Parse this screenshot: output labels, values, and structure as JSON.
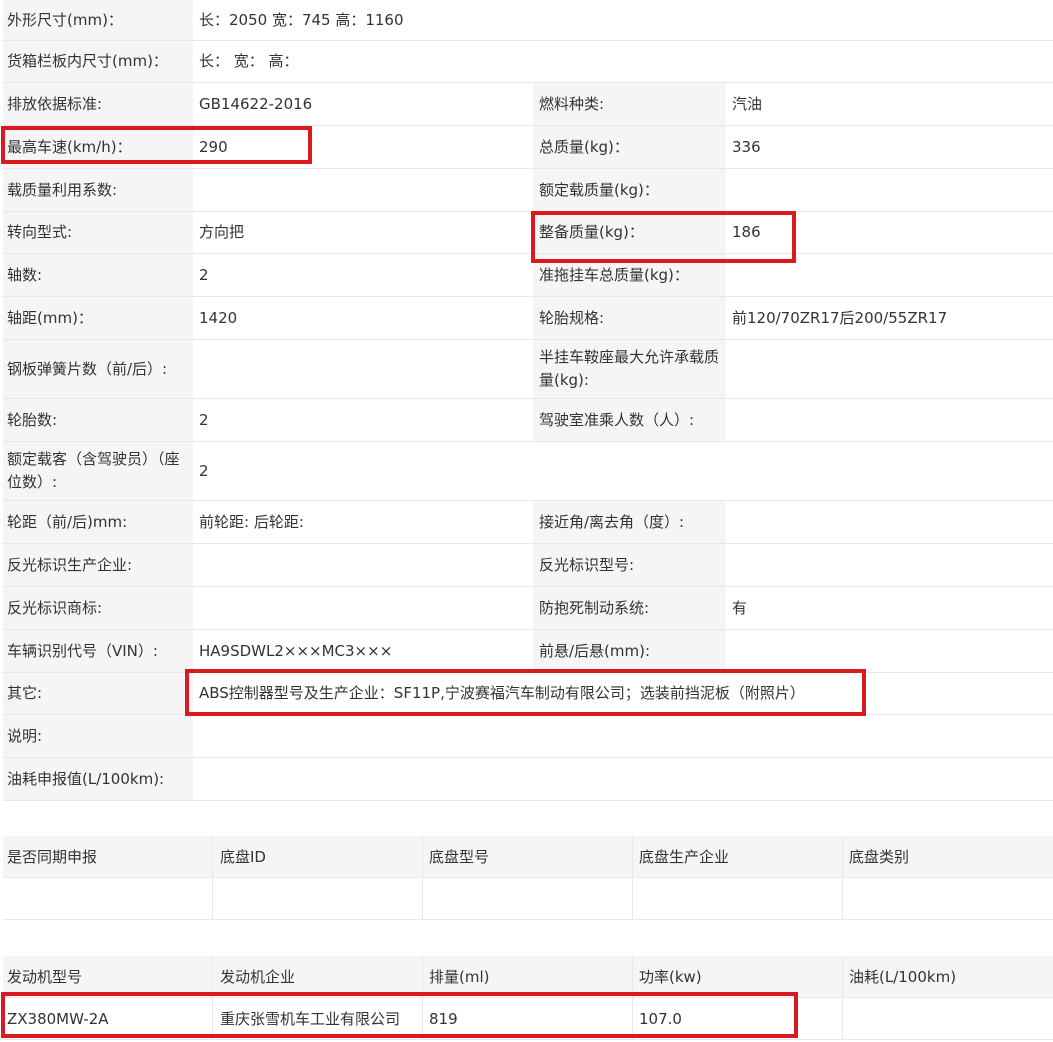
{
  "spec_rows": [
    {
      "type": "wide",
      "h": 41,
      "label": "外形尺寸(mm)：",
      "value": "长：2050 宽：745 高：1160"
    },
    {
      "type": "wide",
      "h": 42,
      "label": "货箱栏板内尺寸(mm)：",
      "value": "长：  宽：  高："
    },
    {
      "type": "pair",
      "h": 43,
      "label1": "排放依据标准:",
      "value1": "GB14622-2016",
      "label2": "燃料种类:",
      "value2": "汽油"
    },
    {
      "type": "pair",
      "h": 43,
      "label1": "最高车速(km/h)：",
      "value1": "290",
      "label2": "总质量(kg)：",
      "value2": "336"
    },
    {
      "type": "pair",
      "h": 43,
      "label1": "载质量利用系数:",
      "value1": "",
      "label2": "额定载质量(kg)：",
      "value2": ""
    },
    {
      "type": "pair",
      "h": 42,
      "label1": "转向型式:",
      "value1": "方向把",
      "label2": "整备质量(kg)：",
      "value2": "186"
    },
    {
      "type": "pair",
      "h": 43,
      "label1": "轴数:",
      "value1": "2",
      "label2": "准拖挂车总质量(kg)：",
      "value2": ""
    },
    {
      "type": "pair",
      "h": 43,
      "label1": "轴距(mm)：",
      "value1": "1420",
      "label2": "轮胎规格:",
      "value2": "前120/70ZR17后200/55ZR17"
    },
    {
      "type": "pair",
      "h": 59,
      "label1": "钢板弹簧片数（前/后）:",
      "value1": "",
      "label2": "半挂车鞍座最大允许承载质量(kg):",
      "value2": ""
    },
    {
      "type": "pair",
      "h": 43,
      "label1": "轮胎数:",
      "value1": "2",
      "label2": "驾驶室准乘人数（人）:",
      "value2": ""
    },
    {
      "type": "wide",
      "h": 59,
      "label": "额定载客（含驾驶员）（座位数）:",
      "value": "2"
    },
    {
      "type": "pair",
      "h": 43,
      "label1": "轮距（前/后)mm:",
      "value1": "前轮距: 后轮距:",
      "label2": "接近角/离去角（度）:",
      "value2": ""
    },
    {
      "type": "pair",
      "h": 43,
      "label1": "反光标识生产企业:",
      "value1": "",
      "label2": "反光标识型号:",
      "value2": ""
    },
    {
      "type": "pair",
      "h": 43,
      "label1": "反光标识商标:",
      "value1": "",
      "label2": "防抱死制动系统:",
      "value2": "有"
    },
    {
      "type": "pair",
      "h": 43,
      "label1": "车辆识别代号（VIN）:",
      "value1": "HA9SDWL2×××MC3×××",
      "label2": "前悬/后悬(mm):",
      "value2": ""
    },
    {
      "type": "wide",
      "h": 42,
      "label": "其它:",
      "value": "ABS控制器型号及生产企业：SF11P,宁波赛福汽车制动有限公司；选装前挡泥板（附照片）"
    },
    {
      "type": "wide",
      "h": 43,
      "label": "说明:",
      "value": ""
    },
    {
      "type": "wide",
      "h": 43,
      "label": "油耗申报值(L/100km):",
      "value": ""
    }
  ],
  "chassis_table": {
    "headers": [
      "是否同期申报",
      "底盘ID",
      "底盘型号",
      "底盘生产企业",
      "底盘类别"
    ],
    "row": [
      "",
      "",
      "",
      "",
      ""
    ]
  },
  "engine_table": {
    "headers": [
      "发动机型号",
      "发动机企业",
      "排量(ml)",
      "功率(kw)",
      "油耗(L/100km)"
    ],
    "row": [
      "ZX380MW-2A",
      "重庆张雪机车工业有限公司",
      "819",
      "107.0",
      ""
    ]
  },
  "highlight_color": "#d91a20"
}
